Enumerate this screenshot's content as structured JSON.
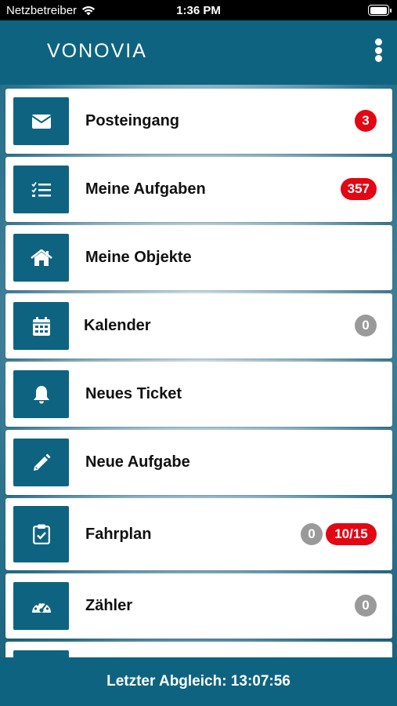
{
  "status_bar": {
    "carrier": "Netzbetreiber",
    "time": "1:36 PM"
  },
  "header": {
    "logo": "VONOVIA"
  },
  "menu": [
    {
      "label": "Posteingang",
      "badges": [
        {
          "text": "3",
          "color": "red"
        }
      ]
    },
    {
      "label": "Meine Aufgaben",
      "badges": [
        {
          "text": "357",
          "color": "red"
        }
      ]
    },
    {
      "label": "Meine Objekte",
      "badges": []
    },
    {
      "label": "Kalender",
      "badges": [
        {
          "text": "0",
          "color": "grey"
        }
      ]
    },
    {
      "label": "Neues Ticket",
      "badges": []
    },
    {
      "label": "Neue Aufgabe",
      "badges": []
    },
    {
      "label": "Fahrplan",
      "badges": [
        {
          "text": "0",
          "color": "grey"
        },
        {
          "text": "10/15",
          "color": "red"
        }
      ]
    },
    {
      "label": "Zähler",
      "badges": [
        {
          "text": "0",
          "color": "grey"
        }
      ]
    }
  ],
  "icons": [
    "envelope-icon",
    "checklist-icon",
    "home-icon",
    "calendar-icon",
    "bell-icon",
    "pencil-icon",
    "clipboard-check-icon",
    "speedometer-icon"
  ],
  "footer": {
    "last_sync": "Letzter Abgleich: 13:07:56"
  },
  "colors": {
    "primary": "#0e6480",
    "badge_red": "#e30613",
    "badge_grey": "#9a9a9a"
  }
}
